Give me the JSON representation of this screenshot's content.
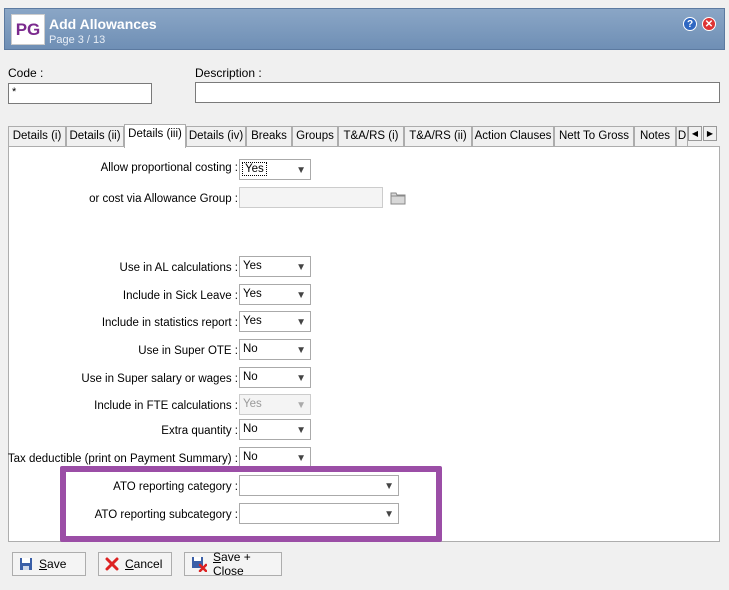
{
  "window": {
    "logo": "PG",
    "title": "Add Allowances",
    "subtitle": "Page 3 / 13",
    "help_icon": "question-icon",
    "close_icon": "close-icon"
  },
  "header": {
    "code_label": "Code :",
    "code_value": "*",
    "description_label": "Description :",
    "description_value": ""
  },
  "tabs": [
    "Details (i)",
    "Details (ii)",
    "Details (iii)",
    "Details (iv)",
    "Breaks",
    "Groups",
    "T&A/RS (i)",
    "T&A/RS (ii)",
    "Action Clauses",
    "Nett To Gross",
    "Notes",
    "D"
  ],
  "active_tab": "Details (iii)",
  "form": {
    "proportional_costing": {
      "label": "Allow proportional costing :",
      "value": "Yes"
    },
    "allowance_group": {
      "label": "or cost via Allowance Group :",
      "value": ""
    },
    "al_calculations": {
      "label": "Use in AL calculations :",
      "value": "Yes"
    },
    "sick_leave": {
      "label": "Include in Sick Leave :",
      "value": "Yes"
    },
    "statistics_report": {
      "label": "Include in statistics report :",
      "value": "Yes"
    },
    "super_ote": {
      "label": "Use in Super OTE :",
      "value": "No"
    },
    "super_salary": {
      "label": "Use in Super salary or wages :",
      "value": "No"
    },
    "fte_calculations": {
      "label": "Include in FTE calculations :",
      "value": "Yes"
    },
    "extra_quantity": {
      "label": "Extra quantity :",
      "value": "No"
    },
    "tax_deductible": {
      "label": "Tax deductible (print on Payment Summary) :",
      "value": "No"
    },
    "ato_category": {
      "label": "ATO reporting category :",
      "value": ""
    },
    "ato_subcategory": {
      "label": "ATO reporting subcategory :",
      "value": ""
    }
  },
  "buttons": {
    "save_first": "S",
    "save_rest": "ave",
    "cancel_first": "C",
    "cancel_rest": "ancel",
    "save_close_first": "S",
    "save_close_rest": "ave + Close"
  },
  "colors": {
    "highlight": "#9b4ea6",
    "titlebar": "#7b98bc",
    "logo_text": "#7b2a8e"
  }
}
